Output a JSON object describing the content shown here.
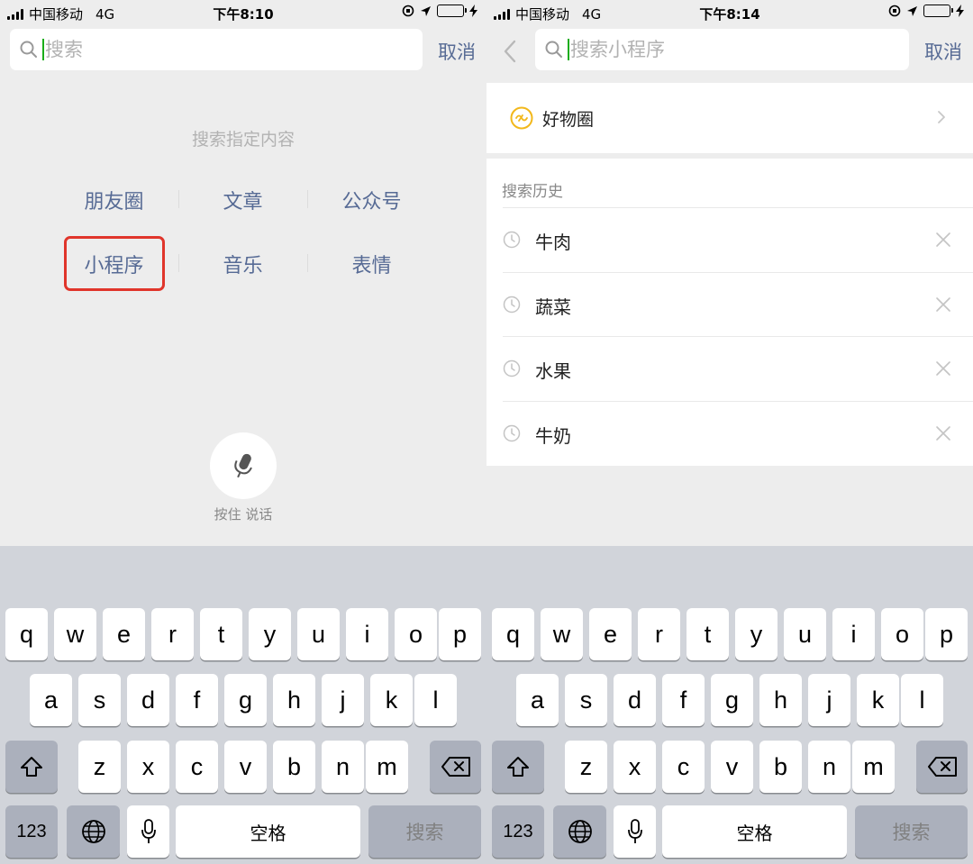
{
  "status_left": {
    "carrier": "中国移动",
    "network": "4G",
    "time": "下午8:10"
  },
  "status_right": {
    "carrier": "中国移动",
    "network": "4G",
    "time": "下午8:14"
  },
  "screen_left": {
    "search_placeholder": "搜索",
    "cancel_label": "取消",
    "hint": "搜索指定内容",
    "categories": [
      [
        "朋友圈",
        "文章",
        "公众号"
      ],
      [
        "小程序",
        "音乐",
        "表情"
      ]
    ],
    "highlighted_category": "小程序",
    "voice_label": "按住 说话"
  },
  "screen_right": {
    "search_placeholder": "搜索小程序",
    "cancel_label": "取消",
    "featured": "好物圈",
    "history_title": "搜索历史",
    "history": [
      "牛肉",
      "蔬菜",
      "水果",
      "牛奶"
    ]
  },
  "keyboard": {
    "row1": [
      "q",
      "w",
      "e",
      "r",
      "t",
      "y",
      "u",
      "i",
      "o",
      "p"
    ],
    "row2": [
      "a",
      "s",
      "d",
      "f",
      "g",
      "h",
      "j",
      "k",
      "l"
    ],
    "row3": [
      "z",
      "x",
      "c",
      "v",
      "b",
      "n",
      "m"
    ],
    "numbers_label": "123",
    "space_label": "空格",
    "search_label": "搜索"
  },
  "colors": {
    "link": "#576b95",
    "caret": "#1aad19",
    "highlight": "#e0352b",
    "battery": "#4cd964"
  }
}
